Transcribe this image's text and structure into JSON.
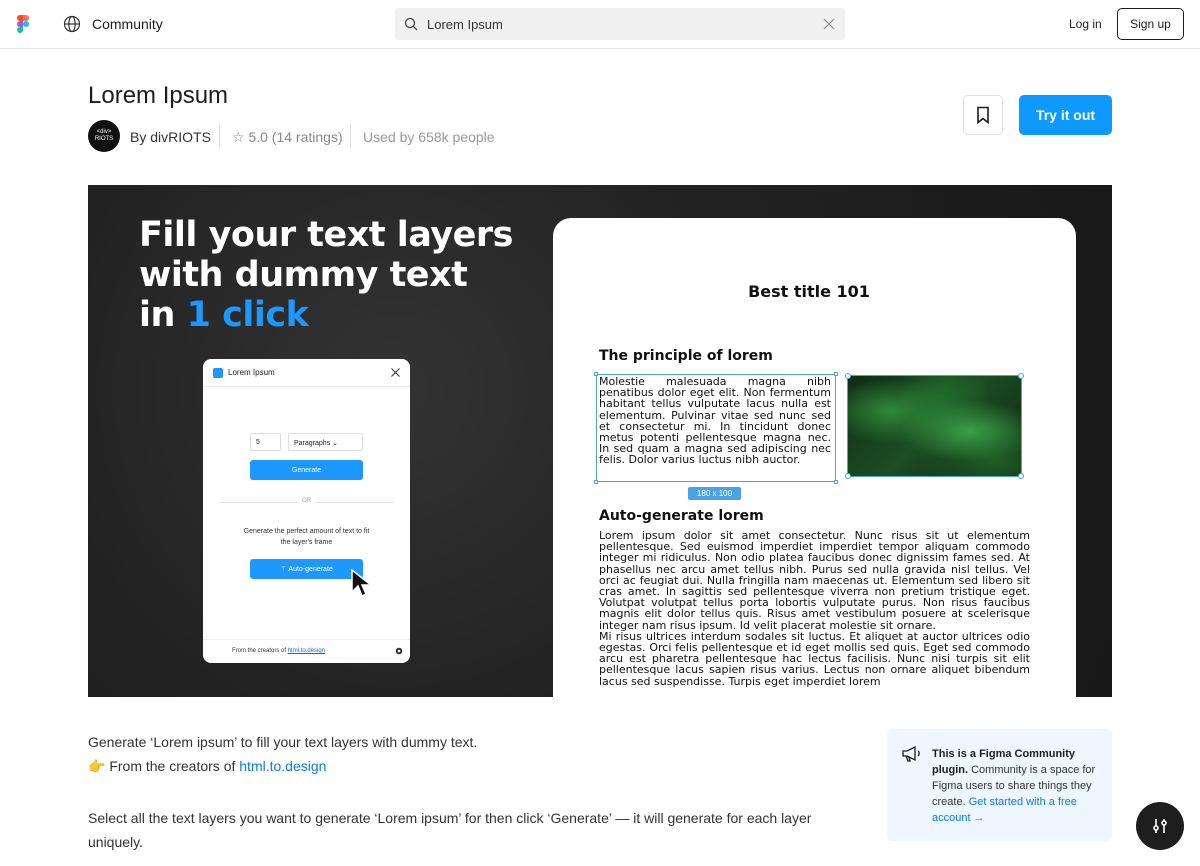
{
  "topbar": {
    "community_label": "Community",
    "search_value": "Lorem Ipsum",
    "login_label": "Log in",
    "signup_label": "Sign up"
  },
  "header": {
    "title": "Lorem Ipsum",
    "avatar_text": "<div> RIOTS",
    "author": "By divRIOTS",
    "rating": "5.0 (14 ratings)",
    "used_by": "Used by 658k people",
    "try_label": "Try it out"
  },
  "hero": {
    "line1": "Fill your text layers",
    "line2": "with dummy text",
    "line3_prefix": "in ",
    "line3_highlight": "1 click",
    "plugin": {
      "title": "Lorem Ipsum",
      "count_value": "5",
      "unit_select": "Paragraphs",
      "generate_label": "Generate",
      "or_label": "OR",
      "auto_description": "Generate the perfect amount of text to fit the layer's frame",
      "auto_label": "Auto-generate",
      "footer_prefix": "From the creators of ",
      "footer_link": "html.to.design"
    },
    "document": {
      "title": "Best title 101",
      "heading1": "The principle of lorem",
      "paragraph1": "Molestie malesuada magna nibh penatibus dolor eget elit. Non fermentum habitant tellus vulputate lacus nulla est elementum. Pulvinar vitae sed nunc sed et consectetur mi. In tincidunt donec metus potenti pellentesque magna nec. In sed quam a magna sed adipiscing nec felis. Dolor varius luctus nibh auctor.",
      "dimension_badge": "180 x 100",
      "heading2": "Auto-generate lorem",
      "paragraph2": "Lorem ipsum dolor sit amet consectetur. Nunc risus sit ut elementum pellentesque. Sed euismod imperdiet imperdiet tempor aliquam commodo integer mi ridiculus. Non odio platea faucibus donec dignissim fames sed. At phasellus nec arcu amet tellus nibh. Purus sed nulla gravida nisl tellus. Vel orci ac feugiat dui. Nulla fringilla nam maecenas ut. Elementum sed libero sit cras amet. In sagittis sed pellentesque viverra non pretium tristique eget. Volutpat volutpat tellus porta lobortis vulputate purus. Non risus faucibus magnis elit dolor tellus quis. Risus amet vestibulum posuere at scelerisque integer nam risus ipsum. Id velit placerat molestie sit ornare.",
      "paragraph3": "Mi risus ultrices interdum sodales sit luctus. Et aliquet at auctor ultrices odio egestas. Orci felis pellentesque et id eget mollis sed quis. Eget sed commodo arcu est pharetra pellentesque hac lectus facilisis. Nunc nisi turpis sit elit pellentesque lacus sapien risus varius. Lectus non ornare aliquet bibendum lacus sed suspendisse. Turpis eget imperdiet lorem"
    }
  },
  "description": {
    "line1": "Generate ‘Lorem ipsum’ to fill your text layers with dummy text.",
    "line2_emoji": "👉",
    "line2_prefix": " From the creators of ",
    "line2_link": "html.to.design",
    "line3": "Select all the text layers you want to generate ‘Lorem ipsum’ for then click ‘Generate’ — it will generate for each layer uniquely."
  },
  "info_box": {
    "bold": "This is a Figma Community plugin.",
    "text": " Community is a space for Figma users to share things they create. ",
    "link": "Get started with a free account →"
  },
  "colors": {
    "accent": "#0d99ff",
    "hero_highlight": "#1d98ff",
    "link": "#0d7ae8"
  },
  "icons": [
    "figma-logo-icon",
    "globe-icon",
    "search-icon",
    "close-icon",
    "star-icon",
    "bookmark-icon",
    "gear-icon",
    "megaphone-icon",
    "sliders-icon",
    "cursor-icon"
  ]
}
